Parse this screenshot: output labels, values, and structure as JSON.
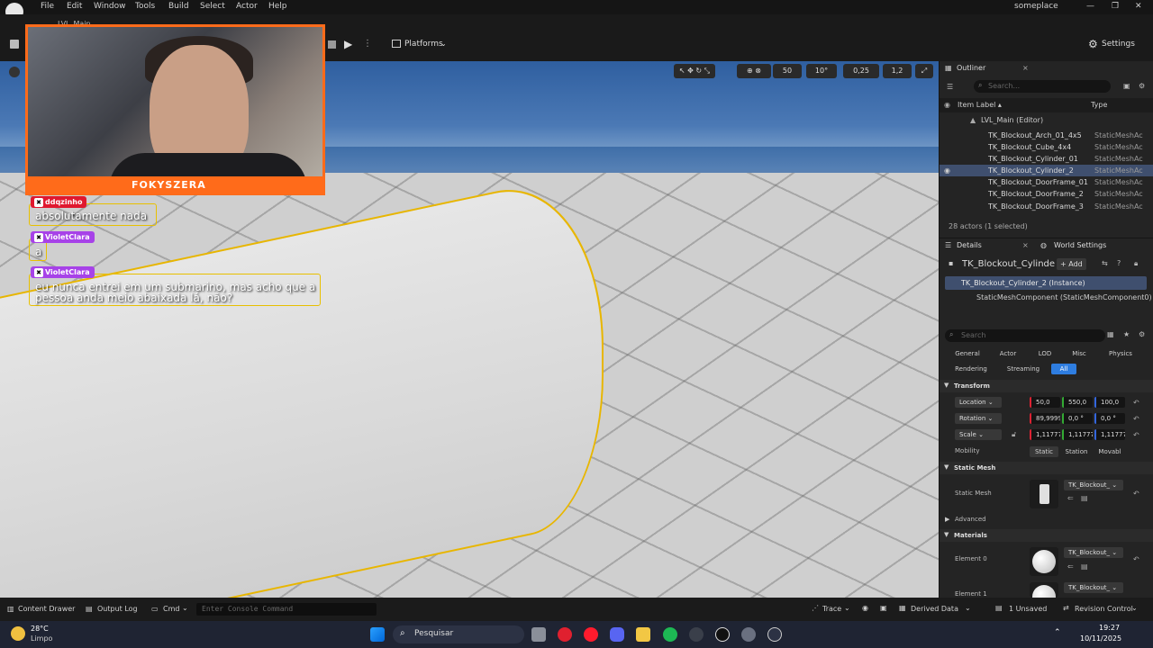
{
  "menu": {
    "items": [
      "File",
      "Edit",
      "Window",
      "Tools",
      "Build",
      "Select",
      "Actor",
      "Help"
    ],
    "project": "someplace",
    "level_tab": "LVL_Main"
  },
  "toolbar": {
    "platforms_label": "Platforms",
    "settings_label": "Settings"
  },
  "viewport": {
    "grid_snap": "50",
    "rot_snap": "10°",
    "scale_snap": "0,25",
    "camera_speed": "1,2"
  },
  "stream": {
    "brand": "FOKYSZERA",
    "chat": [
      {
        "user": "ddqzinho",
        "message": "absolutamente nada",
        "user_color": "#e0182f"
      },
      {
        "user": "VioletClara",
        "message": "a",
        "user_color": "#a742e8"
      },
      {
        "user": "VioletClara",
        "message": "eu nunca entrei em um submarino, mas acho que a pessoa anda meio abaixada lá, não?",
        "user_color": "#a742e8"
      }
    ]
  },
  "outliner": {
    "title": "Outliner",
    "search_placeholder": "Search...",
    "col_label": "Item Label ▴",
    "col_type": "Type",
    "level": "LVL_Main (Editor)",
    "rows": [
      {
        "name": "TK_Blockout_Arch_01_4x5",
        "type": "StaticMeshAc"
      },
      {
        "name": "TK_Blockout_Cube_4x4",
        "type": "StaticMeshAc"
      },
      {
        "name": "TK_Blockout_Cylinder_01",
        "type": "StaticMeshAc"
      },
      {
        "name": "TK_Blockout_Cylinder_2",
        "type": "StaticMeshAc"
      },
      {
        "name": "TK_Blockout_DoorFrame_01",
        "type": "StaticMeshAc"
      },
      {
        "name": "TK_Blockout_DoorFrame_2",
        "type": "StaticMeshAc"
      },
      {
        "name": "TK_Blockout_DoorFrame_3",
        "type": "StaticMeshAc"
      }
    ],
    "footer": "28 actors (1 selected)"
  },
  "details": {
    "tab_details": "Details",
    "tab_world": "World Settings",
    "actor_name": "TK_Blockout_Cylinde",
    "add_label": "+ Add",
    "instance": "TK_Blockout_Cylinder_2 (Instance)",
    "component": "StaticMeshComponent (StaticMeshComponent0)",
    "search_placeholder": "Search",
    "categories_row1": [
      "General",
      "Actor",
      "LOD",
      "Misc",
      "Physics"
    ],
    "categories_row2": [
      "Rendering",
      "Streaming",
      "All"
    ],
    "transform_label": "Transform",
    "location_label": "Location",
    "location": [
      "50,0",
      "550,0",
      "100,0"
    ],
    "rotation_label": "Rotation",
    "rotation": [
      "89,9999",
      "0,0 °",
      "0,0 °"
    ],
    "scale_label": "Scale",
    "scale": [
      "1,11777",
      "1,11777",
      "1,11777"
    ],
    "mobility_label": "Mobility",
    "mobility": [
      "Static",
      "Station",
      "Movabl"
    ],
    "static_mesh_section": "Static Mesh",
    "static_mesh_label": "Static Mesh",
    "static_mesh_value": "TK_Blockout_",
    "advanced_label": "Advanced",
    "materials_section": "Materials",
    "element0_label": "Element 0",
    "element0_value": "TK_Blockout_",
    "element1_label": "Element 1",
    "element1_value": "TK_Blockout_"
  },
  "statusbar": {
    "content_drawer": "Content Drawer",
    "output_log": "Output Log",
    "cmd": "Cmd",
    "console_placeholder": "Enter Console Command",
    "trace": "Trace",
    "derived_data": "Derived Data",
    "unsaved": "1 Unsaved",
    "revision": "Revision Control"
  },
  "taskbar": {
    "temp": "28°C",
    "weather": "Limpo",
    "search_placeholder": "Pesquisar",
    "time": "19:27",
    "date": "10/11/2025"
  },
  "colors": {
    "accent": "#2e7de0",
    "selection": "#e8b600",
    "stream_orange": "#ff6b1a"
  }
}
